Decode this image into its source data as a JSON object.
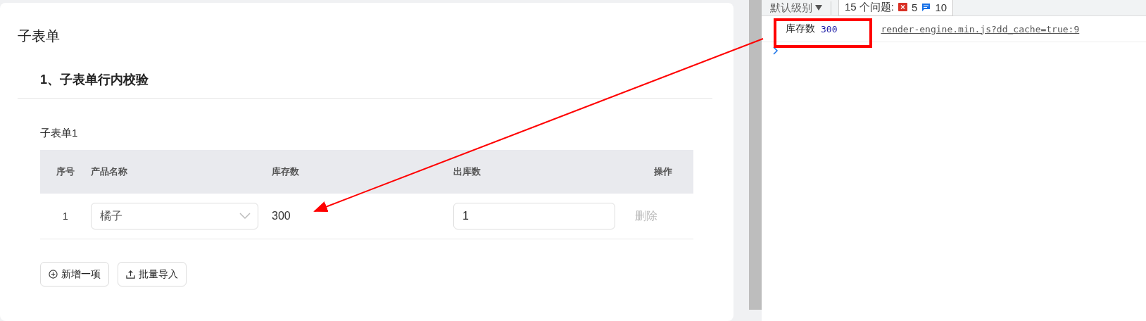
{
  "form": {
    "title": "子表单",
    "section_title": "1、子表单行内校验",
    "subform": {
      "label": "子表单1",
      "columns": [
        "序号",
        "产品名称",
        "库存数",
        "出库数",
        "操作"
      ],
      "rows": [
        {
          "index": "1",
          "product": "橘子",
          "stock": "300",
          "outbound": "1",
          "action": "删除"
        }
      ],
      "buttons": [
        {
          "kind": "add",
          "label": "新增一项"
        },
        {
          "kind": "import",
          "label": "批量导入"
        }
      ]
    }
  },
  "console": {
    "level_filter": "默认级别",
    "issues_label": "15 个问题:",
    "errors": "5",
    "infos": "10",
    "log": {
      "text": "库存数",
      "value": "300",
      "source": "render-engine.min.js?dd_cache=true:9"
    }
  }
}
